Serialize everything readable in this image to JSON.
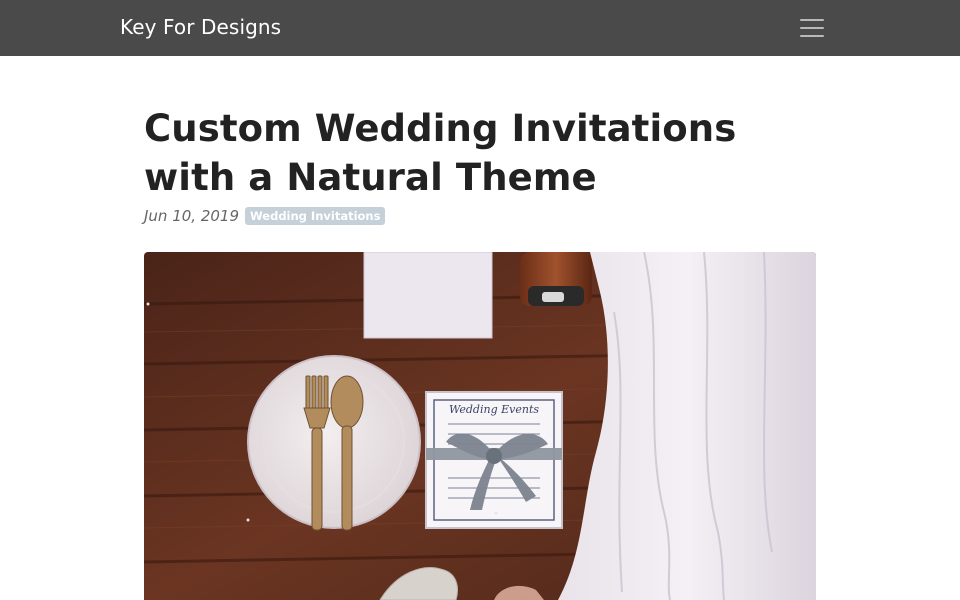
{
  "navbar": {
    "brand": "Key For Designs",
    "menu_icon": "hamburger-menu-icon"
  },
  "article": {
    "title": "Custom Wedding Invitations with a Natural Theme",
    "date": "Jun 10, 2019",
    "category": "Wedding Invitations",
    "hero_image": {
      "card_text": "Wedding Events"
    }
  },
  "colors": {
    "navbar_bg": "#4a4a4a",
    "badge_bg": "#c6d0d8",
    "title_text": "#222222",
    "wood": "#5a2e1d"
  }
}
